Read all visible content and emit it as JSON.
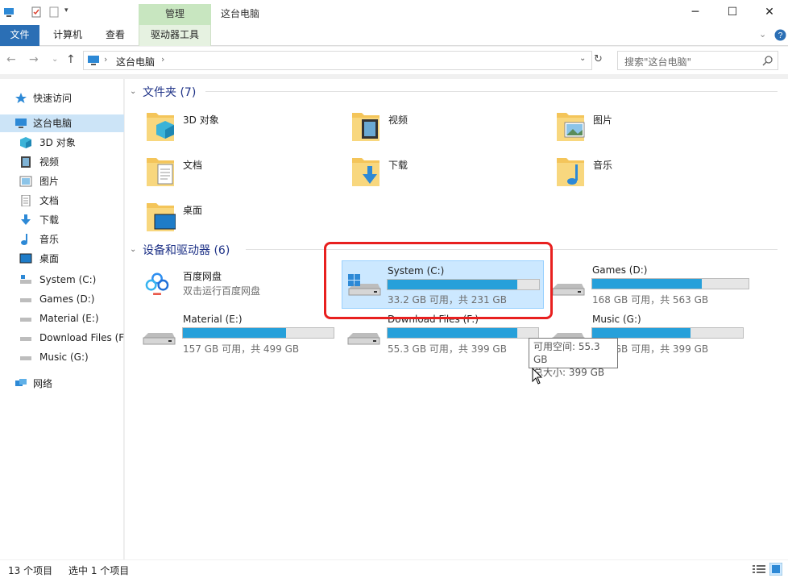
{
  "titlebar": {
    "context_tab": "管理",
    "title": "这台电脑",
    "controls": [
      "─",
      "☐",
      "✕"
    ]
  },
  "ribbon": {
    "tabs": [
      "文件",
      "计算机",
      "查看",
      "驱动器工具"
    ],
    "expand_icon": "chevron-down-icon",
    "help_icon": "help-icon"
  },
  "nav": {
    "back": "←",
    "forward": "→",
    "recent": "⌄",
    "up": "↑",
    "path": "这台电脑",
    "refresh": "↻",
    "search_placeholder": "搜索\"这台电脑\""
  },
  "sidebar": {
    "quick_access": "快速访问",
    "this_pc": "这台电脑",
    "items": [
      "3D 对象",
      "视频",
      "图片",
      "文档",
      "下载",
      "音乐",
      "桌面",
      "System (C:)",
      "Games (D:)",
      "Material (E:)",
      "Download Files (F",
      "Music (G:)"
    ],
    "network": "网络"
  },
  "folders_group": {
    "header": "文件夹 (7)",
    "items": [
      "3D 对象",
      "视频",
      "图片",
      "文档",
      "下载",
      "音乐",
      "桌面"
    ]
  },
  "devices_group": {
    "header": "设备和驱动器 (6)",
    "baidu": {
      "name": "百度网盘",
      "sub": "双击运行百度网盘"
    },
    "drives": [
      {
        "name": "System (C:)",
        "size": "33.2 GB 可用，共 231 GB",
        "used": 0.856
      },
      {
        "name": "Games (D:)",
        "size": "168 GB 可用，共 563 GB",
        "used": 0.702
      },
      {
        "name": "Material (E:)",
        "size": "157 GB 可用，共 499 GB",
        "used": 0.685
      },
      {
        "name": "Download Files (F:)",
        "size": "55.3 GB 可用，共 399 GB",
        "used": 0.861
      },
      {
        "name": "Music (G:)",
        "size": "138 GB 可用，共 399 GB",
        "used": 0.654
      }
    ]
  },
  "tooltip": {
    "line1": "可用空间: 55.3 GB",
    "line2": "总大小: 399 GB"
  },
  "status": {
    "count": "13 个项目",
    "selected": "选中 1 个项目"
  },
  "colors": {
    "accent": "#2b6fb5",
    "bar_fill": "#26a0da",
    "selection": "#cce8ff",
    "highlight": "#e8201f"
  }
}
